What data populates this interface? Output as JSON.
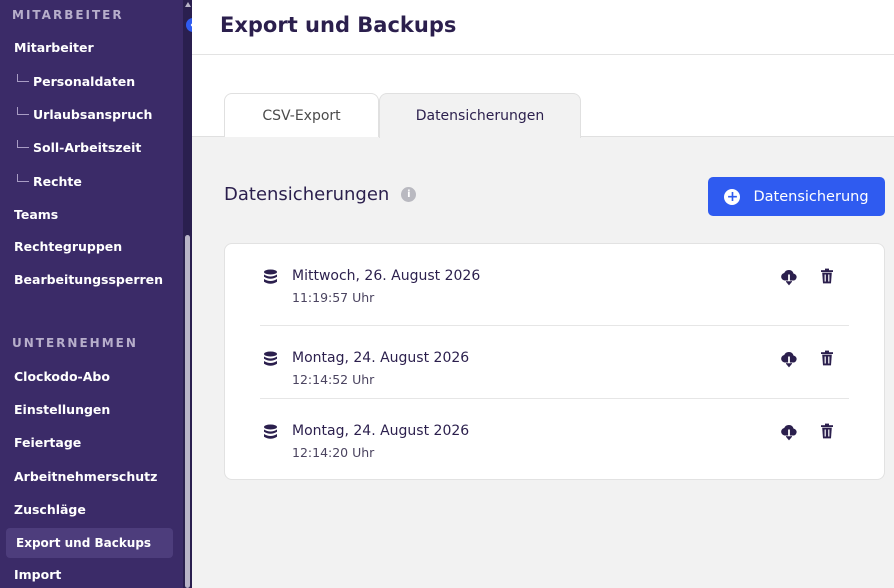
{
  "sidebar": {
    "section_mitarbeiter": "MITARBEITER",
    "section_unternehmen": "UNTERNEHMEN",
    "items": [
      {
        "label": "Mitarbeiter"
      },
      {
        "label": "Personaldaten"
      },
      {
        "label": "Urlaubsanspruch"
      },
      {
        "label": "Soll-Arbeitszeit"
      },
      {
        "label": "Rechte"
      },
      {
        "label": "Teams"
      },
      {
        "label": "Rechtegruppen"
      },
      {
        "label": "Bearbeitungssperren"
      },
      {
        "label": "Clockodo-Abo"
      },
      {
        "label": "Einstellungen"
      },
      {
        "label": "Feiertage"
      },
      {
        "label": "Arbeitnehmerschutz"
      },
      {
        "label": "Zuschläge"
      },
      {
        "label": "Export und Backups"
      },
      {
        "label": "Import"
      }
    ]
  },
  "header": {
    "title": "Export und Backups"
  },
  "tabs": [
    {
      "label": "CSV-Export"
    },
    {
      "label": "Datensicherungen"
    }
  ],
  "main": {
    "heading": "Datensicherungen",
    "info_glyph": "i",
    "add_button_label": "Datensicherung",
    "add_button_glyph": "+",
    "backups": [
      {
        "date": "Mittwoch, 26. August 2026",
        "time": "11:19:57 Uhr"
      },
      {
        "date": "Montag, 24. August 2026",
        "time": "12:14:52 Uhr"
      },
      {
        "date": "Montag, 24. August 2026",
        "time": "12:14:20 Uhr"
      }
    ]
  },
  "colors": {
    "sidebar_bg": "#3b2b68",
    "accent": "#2f5bf0",
    "text_dark": "#2b1f4d"
  }
}
